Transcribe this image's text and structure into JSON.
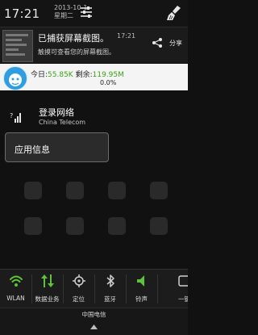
{
  "header": {
    "clock": "17:21",
    "date_line1": "2013-10-1",
    "date_line2": "星期二"
  },
  "screenshot_notification": {
    "title": "已捕获屏幕截图。",
    "time": "17:21",
    "subtitle": "触摸可查看您的屏幕截图。",
    "share_label": "分享"
  },
  "data_notification": {
    "today_label": "今日:",
    "today_value": "55.85K",
    "remaining_label": "剩余:",
    "remaining_value": "119.95M",
    "percent": "0.0%"
  },
  "login_item": {
    "title": "登录网络",
    "subtitle": "China Telecom"
  },
  "menu": {
    "app_info": "应用信息"
  },
  "quick_settings": [
    {
      "label": "WLAN",
      "icon": "wifi-icon"
    },
    {
      "label": "数据业务",
      "icon": "data-arrows-icon"
    },
    {
      "label": "定位",
      "icon": "location-icon"
    },
    {
      "label": "蓝牙",
      "icon": "bluetooth-icon"
    },
    {
      "label": "铃声",
      "icon": "speaker-icon"
    },
    {
      "label": "一键",
      "icon": "more-icon"
    }
  ],
  "carrier": "中国电信",
  "colors": {
    "accent_green": "#3aa317",
    "active_green": "#5fc23a"
  }
}
